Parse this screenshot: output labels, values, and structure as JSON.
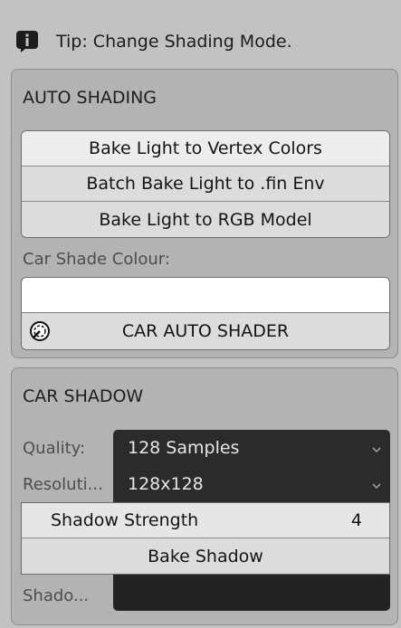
{
  "tip": {
    "icon": "info-icon",
    "text": "Tip: Change Shading Mode."
  },
  "auto_shading": {
    "title": "AUTO SHADING",
    "buttons": [
      "Bake Light to Vertex Colors",
      "Batch Bake Light to .fin Env",
      "Bake Light to RGB Model"
    ],
    "color_label": "Car Shade Colour:",
    "color_value": "#ffffff",
    "shader_button": "CAR AUTO SHADER",
    "shader_icon": "color-picker-icon"
  },
  "car_shadow": {
    "title": "CAR SHADOW",
    "quality_label": "Quality:",
    "quality_value": "128 Samples",
    "resolution_label": "Resoluti...",
    "resolution_value": "128x128",
    "strength_label": "Shadow Strength",
    "strength_value": "4",
    "bake_button": "Bake Shadow",
    "shado_label": "Shado..."
  },
  "colors": {
    "background": "#c2c2c2",
    "panel": "#b3b3b3",
    "button": "#dcdcdc",
    "dropdown": "#2b2b2b"
  }
}
